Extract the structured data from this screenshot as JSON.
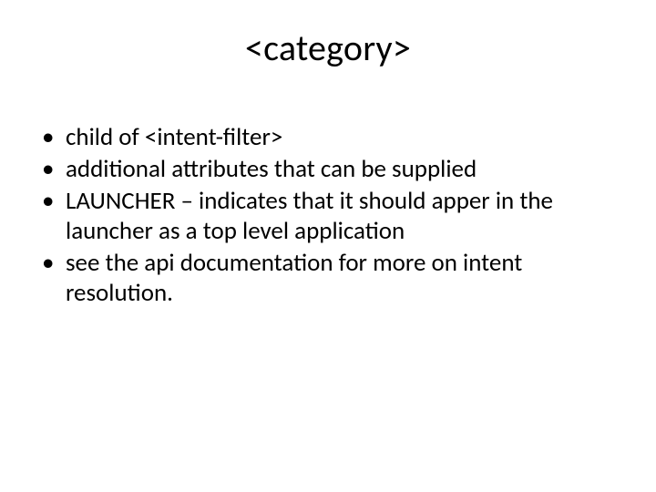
{
  "title": "<category>",
  "bullets": [
    "child of <intent-filter>",
    "additional attributes that can be supplied",
    "LAUNCHER – indicates that it should apper in the launcher as a top level application",
    "see the api documentation for more on intent resolution."
  ]
}
